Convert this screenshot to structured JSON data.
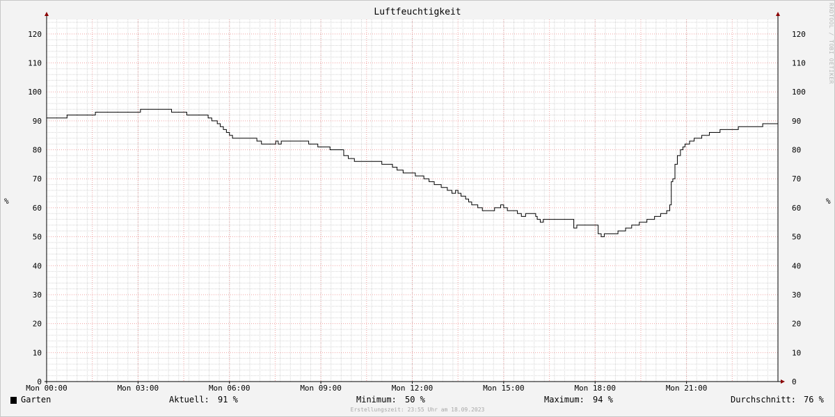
{
  "chart_data": {
    "type": "line",
    "title": "Luftfeuchtigkeit",
    "ylabel": "%",
    "ylim": [
      0,
      125
    ],
    "yticks": [
      0,
      10,
      20,
      30,
      40,
      50,
      60,
      70,
      80,
      90,
      100,
      110,
      120
    ],
    "xlim": [
      0,
      24
    ],
    "xticks": [
      {
        "x": 0,
        "label": "Mon 00:00"
      },
      {
        "x": 3,
        "label": "Mon 03:00"
      },
      {
        "x": 6,
        "label": "Mon 06:00"
      },
      {
        "x": 9,
        "label": "Mon 09:00"
      },
      {
        "x": 12,
        "label": "Mon 12:00"
      },
      {
        "x": 15,
        "label": "Mon 15:00"
      },
      {
        "x": 18,
        "label": "Mon 18:00"
      },
      {
        "x": 21,
        "label": "Mon 21:00"
      }
    ],
    "grid": true,
    "series": [
      {
        "name": "Garten",
        "color": "#000000",
        "step": true,
        "x": [
          0,
          0.67,
          1.6,
          3.08,
          4.1,
          4.6,
          5.3,
          5.42,
          5.6,
          5.7,
          5.8,
          5.9,
          6.0,
          6.1,
          6.25,
          6.9,
          7.05,
          7.4,
          7.52,
          7.6,
          7.7,
          7.9,
          8.6,
          8.9,
          9.3,
          9.75,
          9.9,
          10.1,
          10.4,
          11.0,
          11.2,
          11.35,
          11.5,
          11.7,
          12.1,
          12.38,
          12.55,
          12.72,
          12.85,
          12.95,
          13.05,
          13.15,
          13.3,
          13.42,
          13.5,
          13.6,
          13.75,
          13.85,
          13.95,
          14.15,
          14.3,
          14.55,
          14.7,
          14.9,
          15.0,
          15.12,
          15.45,
          15.58,
          15.72,
          15.8,
          16.05,
          16.1,
          16.2,
          16.3,
          17.3,
          17.4,
          18.1,
          18.2,
          18.3,
          18.65,
          18.75,
          18.85,
          19.0,
          19.2,
          19.45,
          19.7,
          19.95,
          20.15,
          20.2,
          20.35,
          20.45,
          20.5,
          20.55,
          20.62,
          20.7,
          20.8,
          20.88,
          20.95,
          21.1,
          21.25,
          21.5,
          21.75,
          22.1,
          22.7,
          23.5,
          24.0
        ],
        "y": [
          91,
          92,
          93,
          94,
          93,
          92,
          91,
          90,
          89,
          88,
          87,
          86,
          85,
          84,
          84,
          83,
          82,
          82,
          83,
          82,
          83,
          83,
          82,
          81,
          80,
          78,
          77,
          76,
          76,
          75,
          75,
          74,
          73,
          72,
          71,
          70,
          69,
          68,
          68,
          67,
          67,
          66,
          65,
          66,
          65,
          64,
          63,
          62,
          61,
          60,
          59,
          59,
          60,
          61,
          60,
          59,
          58,
          57,
          58,
          58,
          57,
          56,
          55,
          56,
          53,
          54,
          51,
          50,
          51,
          51,
          52,
          52,
          53,
          54,
          55,
          56,
          57,
          58,
          58,
          59,
          61,
          69,
          70,
          75,
          78,
          80,
          81,
          82,
          83,
          84,
          85,
          86,
          87,
          88,
          89,
          91
        ]
      }
    ]
  },
  "units": {
    "left": "%",
    "right": "%"
  },
  "watermark": "RRDTOOL / TOBI OETIKER",
  "legend": {
    "series_name": "Garten",
    "current_label": "Aktuell:",
    "current_value": "91 %",
    "min_label": "Minimum:",
    "min_value": "50 %",
    "max_label": "Maximum:",
    "max_value": "94 %",
    "avg_label": "Durchschnitt:",
    "avg_value": "76 %"
  },
  "footer": "Erstellungszeit: 23:55 Uhr am 18.09.2023"
}
